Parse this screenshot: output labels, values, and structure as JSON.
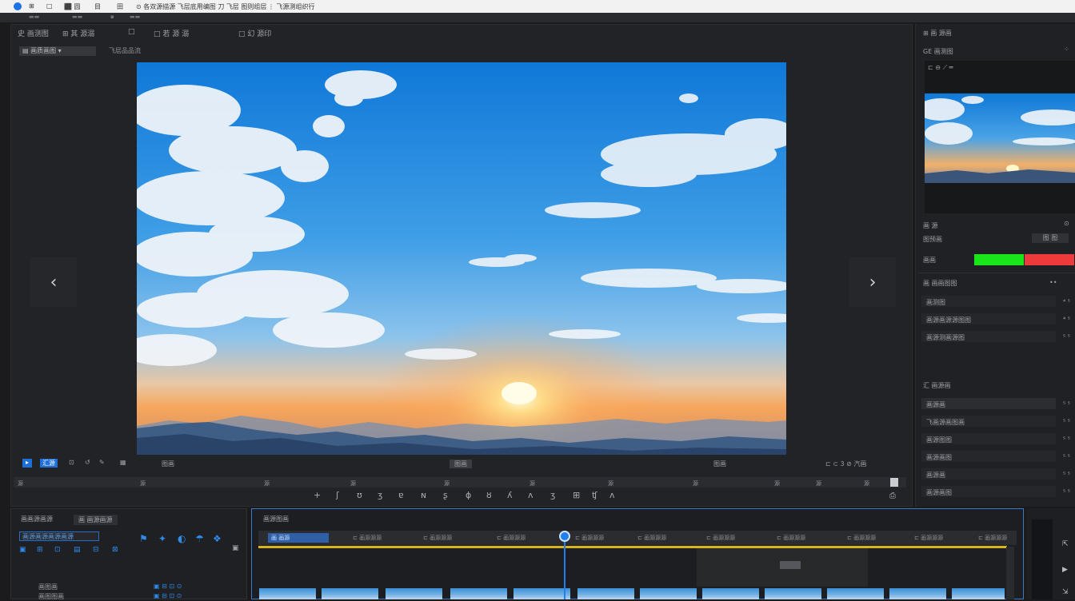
{
  "topbar": {
    "items": [
      "⊞",
      "□",
      "⬛ 圆",
      "目",
      "田",
      "⊙ 各双源描源 飞层底用编图 刀 飞层 图则组层",
      "⋮ 飞源测组织行"
    ]
  },
  "viewer": {
    "tabs": [
      "史 画测图",
      "⊞ 其 源溺",
      "□",
      "□ 若 源 溺",
      "□ 幻 源印"
    ],
    "subtab_active": "▤ 画质画图 ▾",
    "subtab_inactive": "飞层品品流",
    "nav_prev": "‹",
    "nav_next": "›"
  },
  "controls": {
    "left_badge": "▸",
    "left_label": "汇源",
    "mid_label1": "图画",
    "mid_label2": "图画",
    "mid_label3": "图画",
    "right_icons": "⊏ ⊂ 3 ⊘ 汽画",
    "ruler_ticks": [
      "源",
      "源",
      "源",
      "源",
      "源",
      "源",
      "源",
      "源",
      "源",
      "源",
      "源"
    ],
    "tools": [
      "+",
      "ʃ",
      "ʊ",
      "ʒ",
      "ɐ",
      "ɴ",
      "ʂ",
      "ɸ",
      "ȣ",
      "ʎ",
      "ʌ",
      "ʒ",
      "⊞",
      "ʧ",
      "ʌ"
    ]
  },
  "inspector": {
    "header": "⊞ 画 源画",
    "section1": "GE 画测图",
    "icons_row": "⊏ ⊖ ⟋  ═",
    "label_a": "画 源",
    "row_label": "图预画",
    "row_btn": "图 图",
    "color_label": "画画",
    "color_swatch_a": "#19e619",
    "color_swatch_b": "#ee3a3a",
    "section2": "画 画画图图",
    "section2_more": "••",
    "rows2": [
      {
        "label": "画测图",
        "value": "⁴ ⁵"
      },
      {
        "label": "画源画源源图图",
        "value": "⁴ ⁵"
      },
      {
        "label": "画源测画源图",
        "value": "⁵ ⁵"
      }
    ],
    "section3": "汇 画源画",
    "rows3": [
      {
        "label": "画源画",
        "value": "⁵ ⁵"
      },
      {
        "label": "飞画源画图画",
        "value": "⁵ ⁵"
      },
      {
        "label": "画源图图",
        "value": "⁵ ⁵"
      },
      {
        "label": "画源画图",
        "value": "⁵ ⁵"
      },
      {
        "label": "画源画",
        "value": "⁵ ⁵"
      },
      {
        "label": "画源画图",
        "value": "⁵ ⁵"
      }
    ]
  },
  "effects": {
    "tab1": "画画源画源",
    "tab2": "画 画源画源",
    "search_value": "画源画源画源画源",
    "icons": [
      "⚑",
      "✦",
      "◐",
      "☂",
      "❖"
    ],
    "row_icons": [
      "▣",
      "⊞",
      "⊡",
      "▤",
      "⊟",
      "⊠"
    ],
    "bottom_rows": [
      "画图画",
      "画图图画"
    ]
  },
  "timeline": {
    "title": "画源图画",
    "first_clip": "画 画源",
    "ruler_labels": [
      "⊏ 画源源源",
      "⊏ 画源源源",
      "⊏ 画源源源",
      "⊏ 画源源源",
      "⊏ 画源源源",
      "⊏ 画源源源",
      "⊏ 画源源源",
      "⊏ 画源源源",
      "⊏ 画源源源",
      "⊏ 画源源源"
    ]
  }
}
